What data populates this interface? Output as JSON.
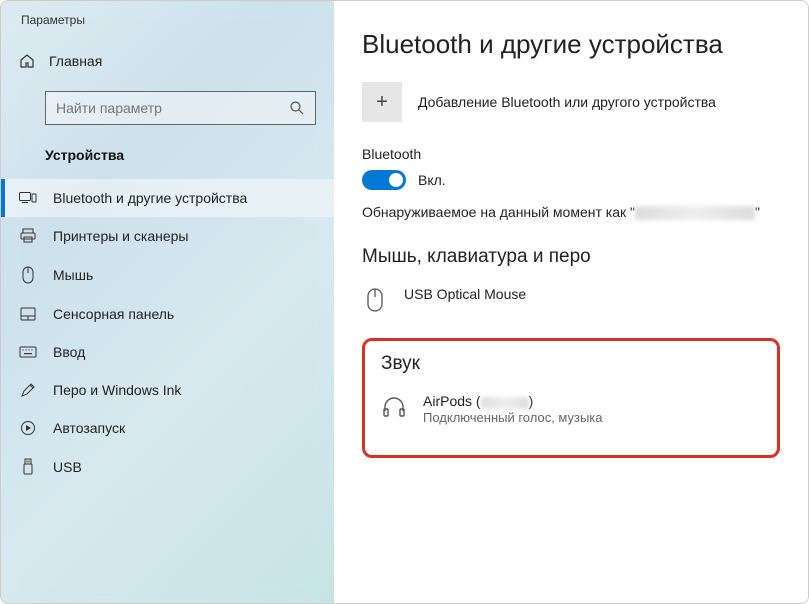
{
  "window": {
    "title": "Параметры"
  },
  "sidebar": {
    "home": "Главная",
    "search_placeholder": "Найти параметр",
    "section": "Устройства",
    "items": [
      {
        "label": "Bluetooth и другие устройства"
      },
      {
        "label": "Принтеры и сканеры"
      },
      {
        "label": "Мышь"
      },
      {
        "label": "Сенсорная панель"
      },
      {
        "label": "Ввод"
      },
      {
        "label": "Перо и Windows Ink"
      },
      {
        "label": "Автозапуск"
      },
      {
        "label": "USB"
      }
    ]
  },
  "content": {
    "title": "Bluetooth и другие устройства",
    "add_label": "Добавление Bluetooth или другого устройства",
    "bluetooth_label": "Bluetooth",
    "toggle_state": "Вкл.",
    "discover_prefix": "Обнаруживаемое на данный момент как \"",
    "discover_suffix": "\"",
    "categories": [
      {
        "title": "Мышь, клавиатура и перо",
        "devices": [
          {
            "name": "USB Optical Mouse",
            "status": ""
          }
        ]
      },
      {
        "title": "Звук",
        "devices": [
          {
            "name_prefix": "AirPods (",
            "name_suffix": ")",
            "status": "Подключенный голос, музыка"
          }
        ]
      }
    ]
  }
}
